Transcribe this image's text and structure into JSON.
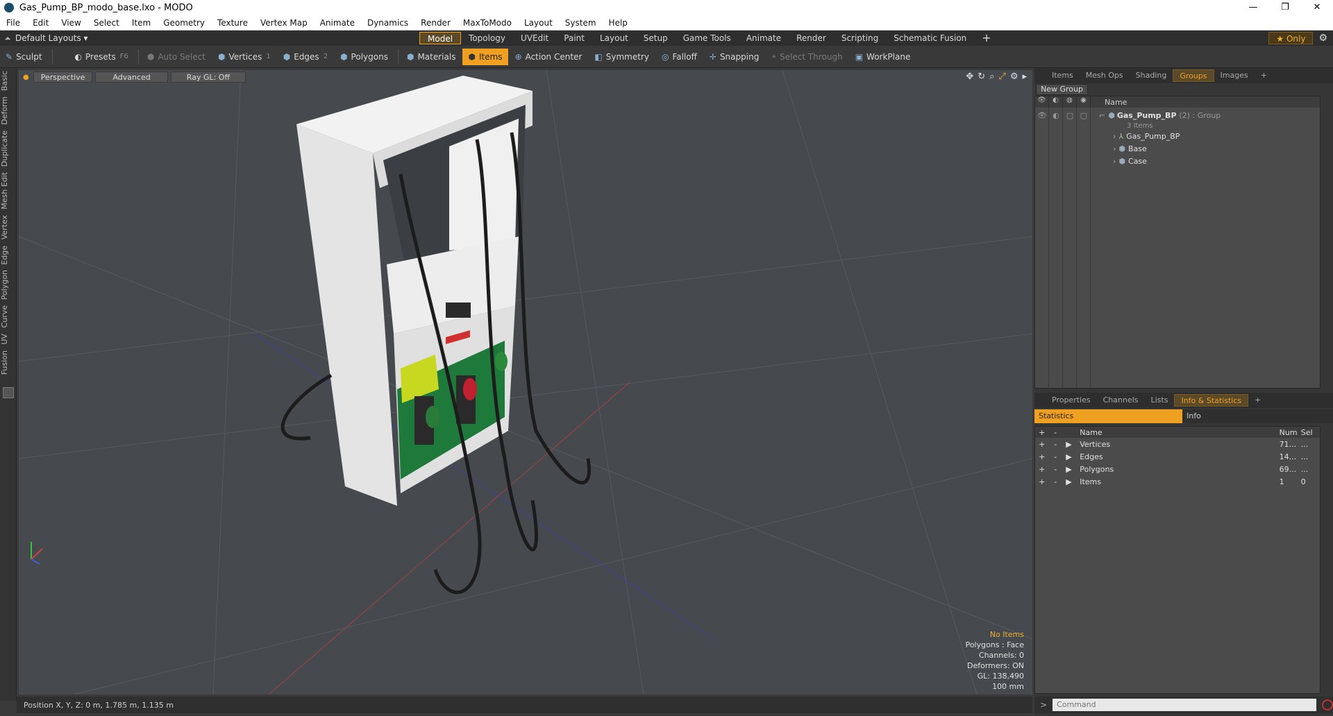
{
  "window": {
    "title": "Gas_Pump_BP_modo_base.lxo - MODO",
    "minimize": "—",
    "maximize": "❐",
    "close": "✕"
  },
  "menu": [
    "File",
    "Edit",
    "View",
    "Select",
    "Item",
    "Geometry",
    "Texture",
    "Vertex Map",
    "Animate",
    "Dynamics",
    "Render",
    "MaxToModo",
    "Layout",
    "System",
    "Help"
  ],
  "layout": {
    "name": "Default Layouts ▾",
    "tabs": [
      "Model",
      "Topology",
      "UVEdit",
      "Paint",
      "Layout",
      "Setup",
      "Game Tools",
      "Animate",
      "Render",
      "Scripting",
      "Schematic Fusion"
    ],
    "active_tab": "Model",
    "add": "+",
    "only": "★ Only",
    "gear": "⚙"
  },
  "toolbar": {
    "sculpt": "Sculpt",
    "presets": "Presets",
    "presets_key": "F6",
    "auto_select": "Auto Select",
    "vertices": "Vertices",
    "vertices_key": "1",
    "edges": "Edges",
    "edges_key": "2",
    "polygons": "Polygons",
    "materials": "Materials",
    "items": "Items",
    "action_center": "Action Center",
    "symmetry": "Symmetry",
    "falloff": "Falloff",
    "snapping": "Snapping",
    "select_through": "Select Through",
    "workplane": "WorkPlane"
  },
  "left_tabs": [
    "Basic",
    "Deform",
    "Duplicate",
    "Mesh Edit",
    "Vertex",
    "Edge",
    "Polygon",
    "Curve",
    "UV",
    "Fusion"
  ],
  "viewport": {
    "view": "Perspective",
    "shading": "Advanced",
    "raygl": "Ray GL: Off",
    "info": {
      "items": "No Items",
      "polygons": "Polygons : Face",
      "channels": "Channels: 0",
      "deformers": "Deformers: ON",
      "gl": "GL: 138,490",
      "scale": "100 mm"
    }
  },
  "status": {
    "position": "Position X, Y, Z:  0 m, 1.785 m, 1.135 m"
  },
  "groups_panel": {
    "tabs": [
      "Items",
      "Mesh Ops",
      "Shading",
      "Groups",
      "Images"
    ],
    "active": "Groups",
    "add": "+",
    "new_group": "New Group",
    "col_name": "Name",
    "group_name": "Gas_Pump_BP",
    "group_suffix": "(2) : Group",
    "group_count": "3 Items",
    "children": [
      "Gas_Pump_BP",
      "Base",
      "Case"
    ]
  },
  "info_panel": {
    "tabs": [
      "Properties",
      "Channels",
      "Lists",
      "Info & Statistics"
    ],
    "active": "Info & Statistics",
    "add": "+",
    "statistics": "Statistics",
    "info": "Info",
    "cols": {
      "name": "Name",
      "num": "Num",
      "sel": "Sel"
    },
    "rows": [
      {
        "name": "Vertices",
        "num": "71...",
        "sel": "..."
      },
      {
        "name": "Edges",
        "num": "14...",
        "sel": "..."
      },
      {
        "name": "Polygons",
        "num": "69...",
        "sel": "..."
      },
      {
        "name": "Items",
        "num": "1",
        "sel": "0"
      }
    ]
  },
  "command": {
    "prompt": ">",
    "placeholder": "Command"
  }
}
